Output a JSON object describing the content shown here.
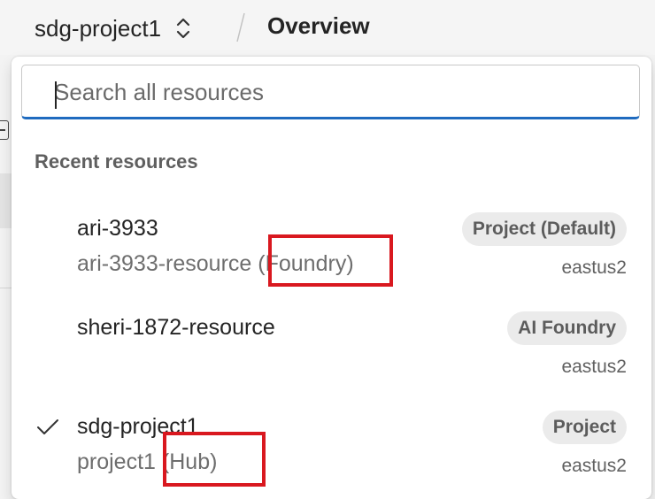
{
  "header": {
    "project_name": "sdg-project1",
    "page_title": "Overview"
  },
  "search": {
    "placeholder": "Search all resources",
    "value": ""
  },
  "recent": {
    "label": "Recent resources",
    "items": [
      {
        "name": "ari-3933",
        "sub_main": "ari-3933-resource",
        "sub_kind": "(Foundry)",
        "badge": "Project (Default)",
        "region": "eastus2",
        "selected": false
      },
      {
        "name": "sheri-1872-resource",
        "sub_main": "",
        "sub_kind": "",
        "badge": "AI Foundry",
        "region": "eastus2",
        "selected": false
      },
      {
        "name": "sdg-project1",
        "sub_main": "project1",
        "sub_kind": "(Hub)",
        "badge": "Project",
        "region": "eastus2",
        "selected": true
      }
    ]
  },
  "colors": {
    "accent": "#1f6bbf",
    "highlight": "#d9181f",
    "badge_bg": "#ebebeb"
  },
  "icons": [
    "updown-chevron-icon",
    "check-icon"
  ]
}
